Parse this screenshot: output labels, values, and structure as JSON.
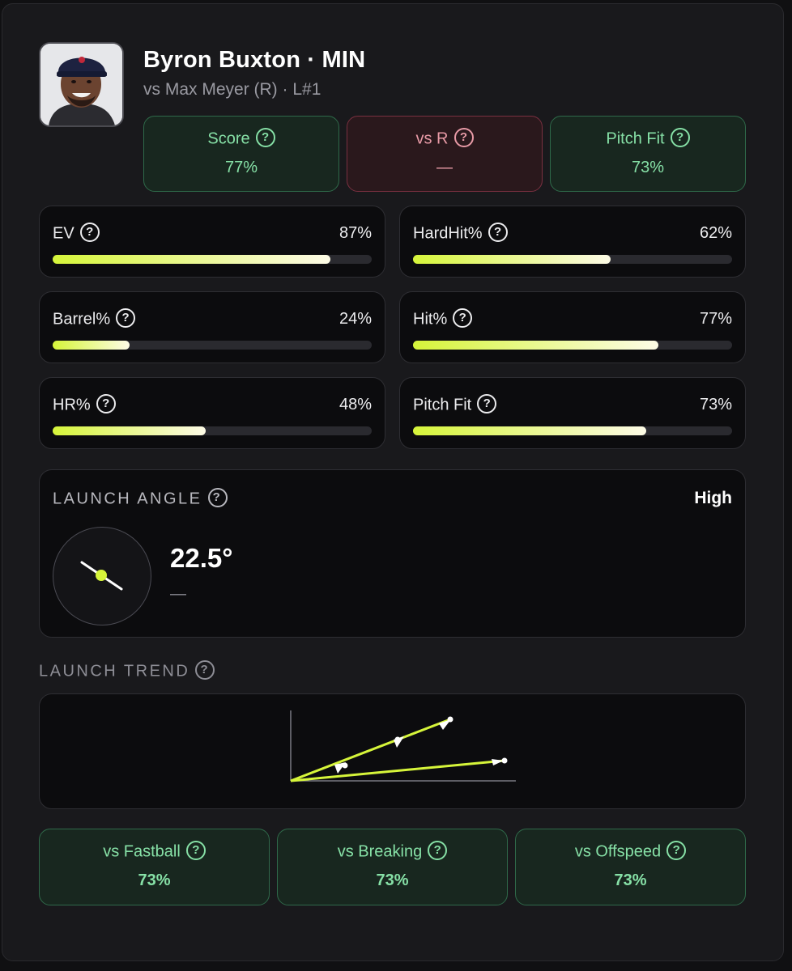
{
  "player": {
    "name": "Byron Buxton · MIN",
    "matchup": "vs Max Meyer (R) · L#1",
    "avatar_icon": "player-headshot"
  },
  "pills": [
    {
      "label": "Score",
      "value": "77%",
      "tone": "green"
    },
    {
      "label": "vs R",
      "value": "—",
      "tone": "red"
    },
    {
      "label": "Pitch Fit",
      "value": "73%",
      "tone": "green"
    }
  ],
  "stats": [
    {
      "label": "EV",
      "value": "87%",
      "fill": 0.87
    },
    {
      "label": "HardHit%",
      "value": "62%",
      "fill": 0.62
    },
    {
      "label": "Barrel%",
      "value": "24%",
      "fill": 0.24
    },
    {
      "label": "Hit%",
      "value": "77%",
      "fill": 0.77
    },
    {
      "label": "HR%",
      "value": "48%",
      "fill": 0.48
    },
    {
      "label": "Pitch Fit",
      "value": "73%",
      "fill": 0.73
    }
  ],
  "launch": {
    "title": "LAUNCH ANGLE",
    "level": "High",
    "angle": "22.5°",
    "sub": "—"
  },
  "trend": {
    "title": "LAUNCH TREND"
  },
  "breakdown": [
    {
      "label": "vs Fastball",
      "value": "73%"
    },
    {
      "label": "vs Breaking",
      "value": "73%"
    },
    {
      "label": "vs Offspeed",
      "value": "73%"
    }
  ],
  "help_glyph": "?",
  "colors": {
    "accent": "#d6f53a",
    "positive": "#86e0a6",
    "negative": "#e89aa6"
  }
}
